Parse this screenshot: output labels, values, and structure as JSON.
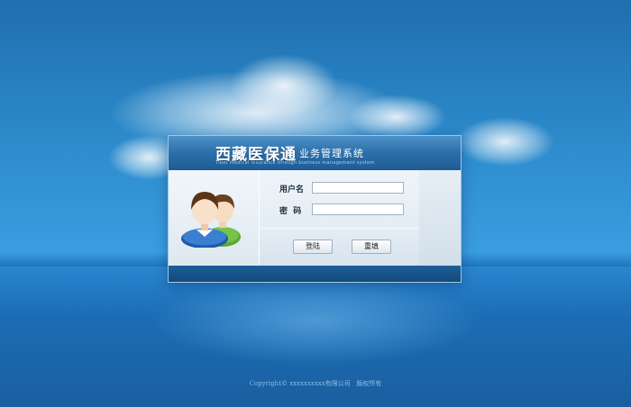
{
  "header": {
    "brand_title": "西藏医保通",
    "brand_subtitle": "业务管理系统",
    "brand_english": "Tibet medical insurance through business management system"
  },
  "form": {
    "username_label": "用户名",
    "password_label": "密  码",
    "username_value": "",
    "password_value": ""
  },
  "buttons": {
    "login": "登陆",
    "reset": "重填"
  },
  "footer": {
    "copyright": "Copyright© xxxxxxxxxx有限公司   版权所有"
  },
  "colors": {
    "sky": "#2f8fd0",
    "header_blue": "#2c6fa9",
    "footer_blue": "#134a7c"
  },
  "icons": {
    "avatar": "users-icon"
  }
}
